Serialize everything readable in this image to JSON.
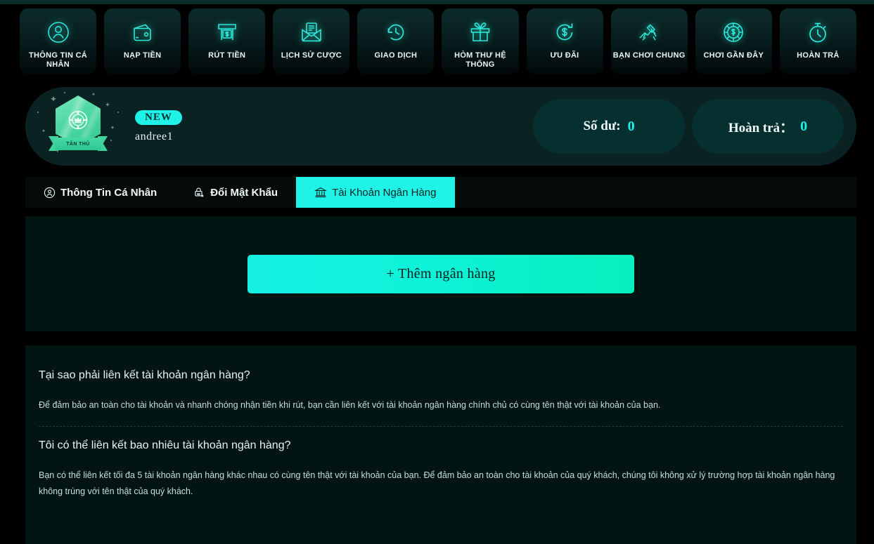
{
  "colors": {
    "accent": "#1ff2e6",
    "page_bg": "#000000",
    "panel_bg": "#021512",
    "card_bg": "#0a2322",
    "balance_bg": "#06302f",
    "tile_top": "#0d2b2b",
    "text": "#e6f4f3"
  },
  "nav": {
    "items": [
      {
        "label": "THÔNG TIN CÁ NHÂN",
        "icon": "user-circle-icon"
      },
      {
        "label": "NẠP TIỀN",
        "icon": "wallet-icon"
      },
      {
        "label": "RÚT TIỀN",
        "icon": "atm-cash-icon"
      },
      {
        "label": "LỊCH SỬ CƯỢC",
        "icon": "envelope-document-icon"
      },
      {
        "label": "GIAO DỊCH",
        "icon": "clock-history-icon"
      },
      {
        "label": "HÒM THƯ HỆ THỐNG",
        "icon": "gift-icon"
      },
      {
        "label": "ƯU ĐÃI",
        "icon": "refund-dollar-icon"
      },
      {
        "label": "BẠN CHƠI CHUNG",
        "icon": "handshake-icon"
      },
      {
        "label": "CHƠI GẦN ĐÂY",
        "icon": "poker-chip-dollar-icon"
      },
      {
        "label": "HOÀN TRẢ",
        "icon": "stopwatch-icon"
      }
    ]
  },
  "profile": {
    "rank_ribbon": "TÂN THỦ",
    "new_badge": "NEW",
    "username": "andree1",
    "balance": {
      "label": "Số dư:",
      "value": "0"
    },
    "rebate": {
      "label": "Hoàn trả：",
      "value": "0"
    }
  },
  "tabs": [
    {
      "label": "Thông Tin Cá Nhân",
      "icon": "user-circle-icon",
      "active": false
    },
    {
      "label": "Đổi Mật Khẩu",
      "icon": "lock-x-icon",
      "active": false
    },
    {
      "label": "Tài Khoản Ngân Hàng",
      "icon": "bank-icon",
      "active": true
    }
  ],
  "add_bank": {
    "button_label": "+ Thêm ngân hàng"
  },
  "faq": [
    {
      "question": "Tại sao phải liên kết tài khoản ngân hàng?",
      "answer": "Để đảm bảo an toàn cho tài khoản và nhanh chóng nhận tiền khi rút, bạn cần liên kết với tài khoản ngân hàng chính chủ có cùng tên thật với tài khoản của bạn."
    },
    {
      "question": "Tôi có thể liên kết bao nhiêu tài khoản ngân hàng?",
      "answer": "Bạn có thể liên kết tối đa 5 tài khoản ngân hàng khác nhau có cùng tên thật với tài khoản của bạn. Để đảm bảo an toàn cho tài khoản của quý khách, chúng tôi không xử lý trường hợp tài khoản ngân hàng không trùng với tên thật của quý khách."
    }
  ]
}
